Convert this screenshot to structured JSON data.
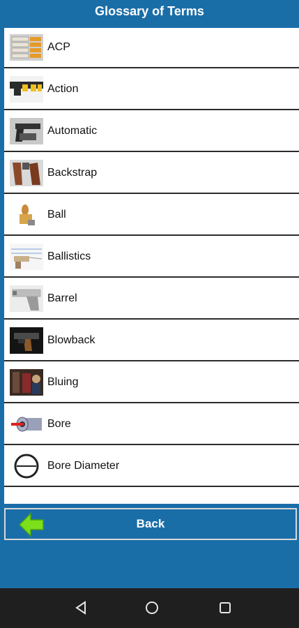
{
  "header": {
    "title": "Glossary of Terms"
  },
  "terms": [
    {
      "label": "ACP",
      "icon": "ammo-boxes-icon"
    },
    {
      "label": "Action",
      "icon": "pistol-action-icon"
    },
    {
      "label": "Automatic",
      "icon": "automatic-pistol-icon"
    },
    {
      "label": "Backstrap",
      "icon": "pistol-grip-icon"
    },
    {
      "label": "Ball",
      "icon": "ball-bullet-icon"
    },
    {
      "label": "Ballistics",
      "icon": "ballistics-chart-icon"
    },
    {
      "label": "Barrel",
      "icon": "pistol-barrel-icon"
    },
    {
      "label": "Blowback",
      "icon": "blowback-pistol-icon"
    },
    {
      "label": "Bluing",
      "icon": "bluing-workshop-icon"
    },
    {
      "label": "Bore",
      "icon": "bore-icon"
    },
    {
      "label": "Bore Diameter",
      "icon": "bore-diameter-icon"
    }
  ],
  "footer": {
    "back_label": "Back",
    "back_icon": "green-back-arrow-icon"
  },
  "system_nav": {
    "icons": [
      "nav-back-icon",
      "nav-home-icon",
      "nav-recents-icon"
    ]
  },
  "colors": {
    "header_bg": "#1a6ea8",
    "accent_green": "#7be01a",
    "nav_bg": "#1f1f1f"
  }
}
